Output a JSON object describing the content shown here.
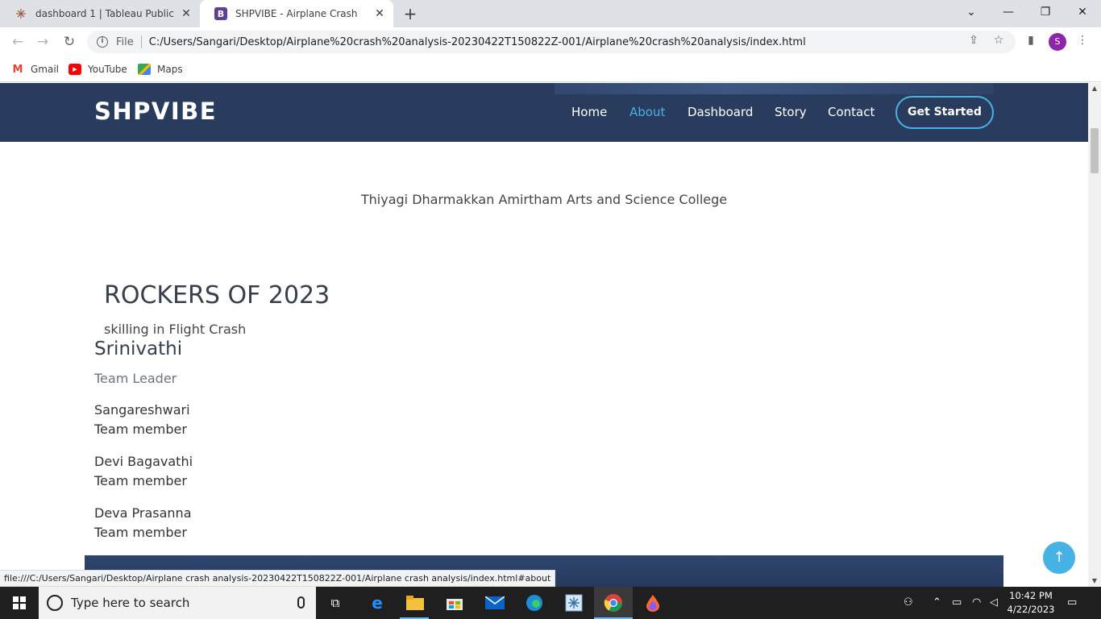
{
  "browser": {
    "tabs": [
      {
        "title": "dashboard 1 | Tableau Public",
        "active": false
      },
      {
        "title": "SHPVIBE - Airplane Crash",
        "active": true
      }
    ],
    "url_scheme_label": "File",
    "url": "C:/Users/Sangari/Desktop/Airplane%20crash%20analysis-20230422T150822Z-001/Airplane%20crash%20analysis/index.html",
    "profile_initial": "S",
    "bookmarks": [
      {
        "label": "Gmail",
        "icon": "gmail-icon"
      },
      {
        "label": "YouTube",
        "icon": "youtube-icon"
      },
      {
        "label": "Maps",
        "icon": "maps-icon"
      }
    ],
    "status_url": "file:///C:/Users/Sangari/Desktop/Airplane crash analysis-20230422T150822Z-001/Airplane crash analysis/index.html#about"
  },
  "site": {
    "logo": "SHPVIBE",
    "nav": [
      {
        "label": "Home"
      },
      {
        "label": "About",
        "active": true
      },
      {
        "label": "Dashboard"
      },
      {
        "label": "Story"
      },
      {
        "label": "Contact"
      }
    ],
    "cta_label": "Get Started",
    "accent_color": "#47b2e4",
    "header_color": "#2a3c5e"
  },
  "content": {
    "college": "Thiyagi Dharmakkan Amirtham Arts and Science College",
    "team_title": "ROCKERS OF 2023",
    "team_subtitle": "skilling in Flight Crash",
    "leader": {
      "name": "Srinivathi",
      "role": "Team Leader"
    },
    "members": [
      {
        "name": "Sangareshwari",
        "role": "Team member"
      },
      {
        "name": "Devi Bagavathi",
        "role": "Team member"
      },
      {
        "name": "Deva Prasanna",
        "role": "Team member"
      }
    ]
  },
  "taskbar": {
    "search_placeholder": "Type here to search",
    "time": "10:42 PM",
    "date": "4/22/2023"
  }
}
